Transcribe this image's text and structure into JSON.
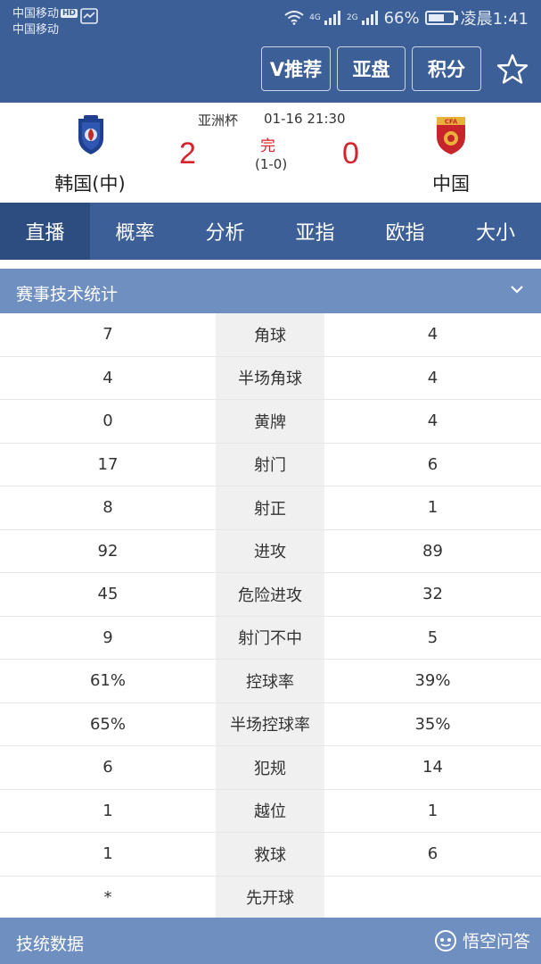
{
  "status_bar": {
    "carrier_1": "中国移动",
    "carrier_1_badge": "HD",
    "carrier_2": "中国移动",
    "net_1": "4G",
    "net_2": "2G",
    "battery": "66%",
    "battery_level": 0.66,
    "time": "凌晨1:41"
  },
  "toolbar": {
    "v_recommend": "V推荐",
    "asian_handicap": "亚盘",
    "points": "积分"
  },
  "match": {
    "competition": "亚洲杯",
    "datetime": "01-16 21:30",
    "home_team": "韩国(中)",
    "away_team": "中国",
    "home_score": "2",
    "away_score": "0",
    "status": "完",
    "halftime": "(1-0)"
  },
  "tabs": [
    {
      "label": "直播"
    },
    {
      "label": "概率"
    },
    {
      "label": "分析"
    },
    {
      "label": "亚指"
    },
    {
      "label": "欧指"
    },
    {
      "label": "大小"
    }
  ],
  "section": {
    "title": "赛事技术统计"
  },
  "stats": [
    {
      "label": "角球",
      "home": "7",
      "away": "4"
    },
    {
      "label": "半场角球",
      "home": "4",
      "away": "4"
    },
    {
      "label": "黄牌",
      "home": "0",
      "away": "4"
    },
    {
      "label": "射门",
      "home": "17",
      "away": "6"
    },
    {
      "label": "射正",
      "home": "8",
      "away": "1"
    },
    {
      "label": "进攻",
      "home": "92",
      "away": "89"
    },
    {
      "label": "危险进攻",
      "home": "45",
      "away": "32"
    },
    {
      "label": "射门不中",
      "home": "9",
      "away": "5"
    },
    {
      "label": "控球率",
      "home": "61%",
      "away": "39%"
    },
    {
      "label": "半场控球率",
      "home": "65%",
      "away": "35%"
    },
    {
      "label": "犯规",
      "home": "6",
      "away": "14"
    },
    {
      "label": "越位",
      "home": "1",
      "away": "1"
    },
    {
      "label": "救球",
      "home": "1",
      "away": "6"
    },
    {
      "label": "先开球",
      "home": "*",
      "away": ""
    }
  ],
  "bottom": {
    "title": "技统数据",
    "watermark": "悟空问答"
  },
  "colors": {
    "header_bg": "#3d5f97",
    "tab_active": "#2d4c80",
    "section_bg": "#6f8fc0",
    "score_red": "#d7232b",
    "label_bg": "#f0f0f0"
  }
}
